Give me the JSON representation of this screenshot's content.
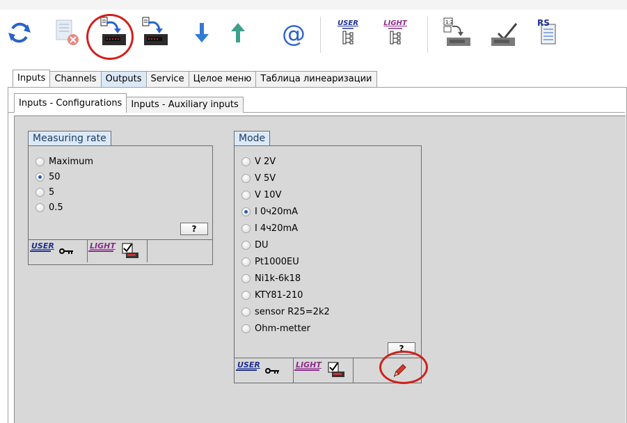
{
  "colors": {
    "accent": "#2a62c9",
    "highlight_ring": "#d0201c",
    "panel_bg": "#d8d8d8",
    "title_bg": "#dbe9f7"
  },
  "toolbar": {
    "items": [
      {
        "icon": "refresh-icon"
      },
      {
        "icon": "disconnect-icon"
      },
      {
        "icon": "read-from-device-icon",
        "circled": true
      },
      {
        "icon": "write-to-device-icon"
      },
      {
        "icon": "download-arrow-icon"
      },
      {
        "icon": "upload-arrow-icon"
      },
      {
        "icon": "email-at-icon"
      },
      {
        "icon": "user-menu-tree-icon",
        "label": "USER"
      },
      {
        "icon": "light-menu-tree-icon",
        "label": "LIGHT"
      },
      {
        "icon": "calibration-device-icon"
      },
      {
        "icon": "device-check-icon"
      },
      {
        "icon": "rs-document-icon",
        "label": "RS"
      }
    ]
  },
  "main_tabs": [
    "Inputs",
    "Channels",
    "Outputs",
    "Service",
    "Целое меню",
    "Таблица линеаризации"
  ],
  "sub_tabs": [
    "Inputs - Configurations",
    "Inputs - Auxiliary inputs"
  ],
  "measuring_rate": {
    "title": "Measuring rate",
    "options": [
      "Maximum",
      "50",
      "5",
      "0.5"
    ],
    "selected": "50",
    "help_label": "?",
    "user_label": "USER",
    "light_label": "LIGHT"
  },
  "mode": {
    "title": "Mode",
    "options": [
      "V 2V",
      "V 5V",
      "V 10V",
      "I 0ч20mA",
      "I 4ч20mA",
      "DU",
      "Pt1000EU",
      "Ni1k-6k18",
      "KTY81-210",
      "sensor R25=2k2",
      "Ohm-metter"
    ],
    "selected": "I 0ч20mA",
    "help_label": "?",
    "user_label": "USER",
    "light_label": "LIGHT",
    "edit_icon": "pencil-edit-icon"
  }
}
